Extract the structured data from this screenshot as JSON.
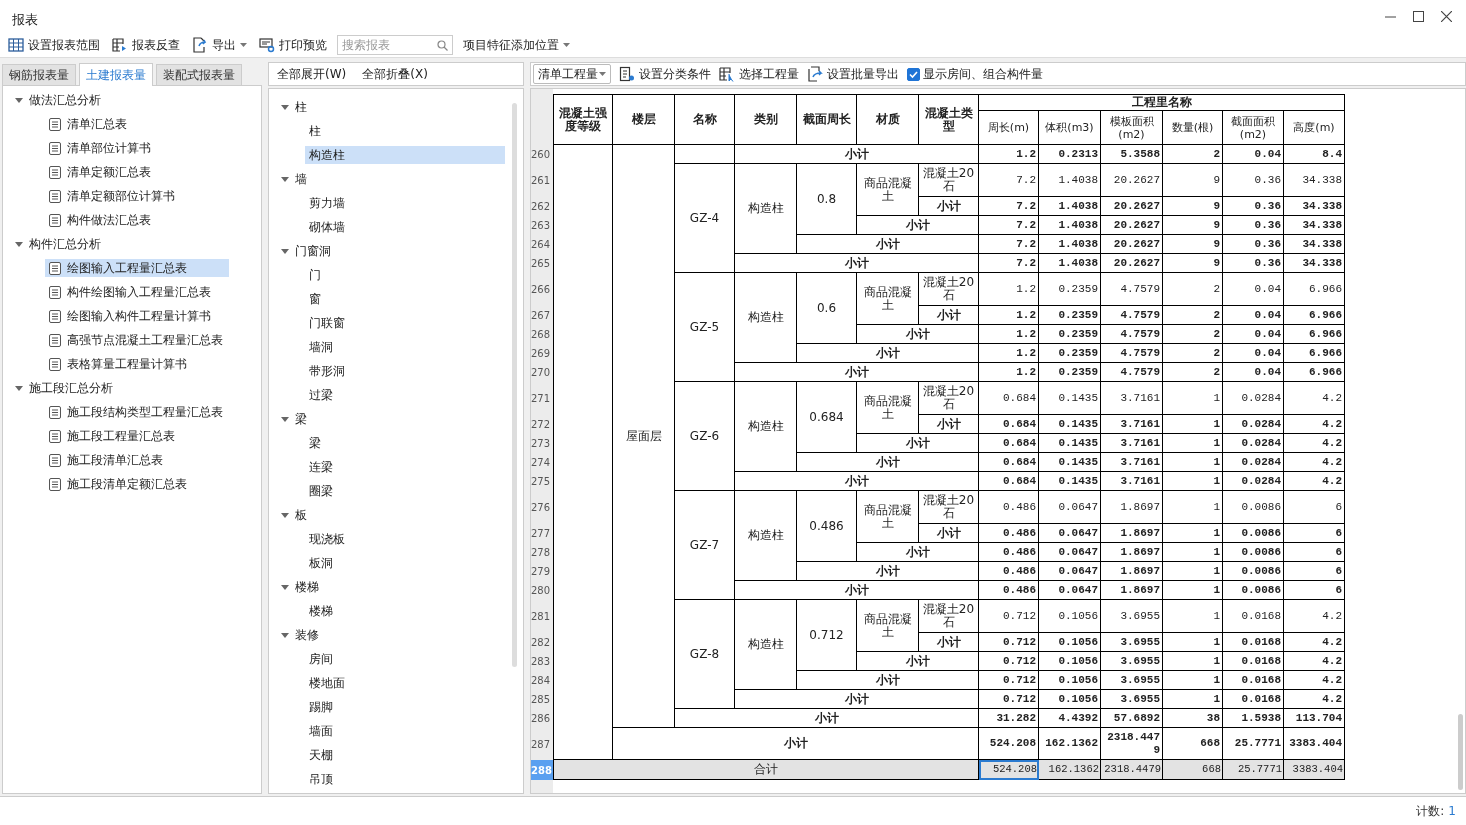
{
  "window": {
    "title": "报表"
  },
  "toolbar": {
    "buttons": [
      {
        "label": "设置报表范围",
        "dropdown": false
      },
      {
        "label": "报表反查",
        "dropdown": false
      },
      {
        "label": "导出",
        "dropdown": true
      },
      {
        "label": "打印预览",
        "dropdown": false
      }
    ],
    "search": {
      "placeholder": "搜索报表"
    },
    "position_dropdown": {
      "label": "项目特征添加位置"
    }
  },
  "tabs": [
    {
      "label": "钢筋报表量",
      "selected": false
    },
    {
      "label": "土建报表量",
      "selected": true
    },
    {
      "label": "装配式报表量",
      "selected": false
    }
  ],
  "report_tree": [
    {
      "label": "做法汇总分析",
      "expanded": true,
      "selected": false,
      "children": [
        {
          "label": "清单汇总表",
          "selected": false
        },
        {
          "label": "清单部位计算书",
          "selected": false
        },
        {
          "label": "清单定额汇总表",
          "selected": false
        },
        {
          "label": "清单定额部位计算书",
          "selected": false
        },
        {
          "label": "构件做法汇总表",
          "selected": false
        }
      ]
    },
    {
      "label": "构件汇总分析",
      "expanded": true,
      "selected": false,
      "children": [
        {
          "label": "绘图输入工程量汇总表",
          "selected": true
        },
        {
          "label": "构件绘图输入工程量汇总表",
          "selected": false
        },
        {
          "label": "绘图输入构件工程量计算书",
          "selected": false
        },
        {
          "label": "高强节点混凝土工程量汇总表",
          "selected": false
        },
        {
          "label": "表格算量工程量计算书",
          "selected": false
        }
      ]
    },
    {
      "label": "施工段汇总分析",
      "expanded": true,
      "selected": false,
      "children": [
        {
          "label": "施工段结构类型工程量汇总表",
          "selected": false
        },
        {
          "label": "施工段工程量汇总表",
          "selected": false
        },
        {
          "label": "施工段清单汇总表",
          "selected": false
        },
        {
          "label": "施工段清单定额汇总表",
          "selected": false
        }
      ]
    }
  ],
  "category_panel": {
    "buttons": [
      "全部展开(W)",
      "全部折叠(X)"
    ],
    "tree": [
      {
        "label": "柱",
        "expanded": true,
        "selected": false,
        "children": [
          {
            "label": "柱",
            "selected": false
          },
          {
            "label": "构造柱",
            "selected": true
          }
        ]
      },
      {
        "label": "墙",
        "expanded": true,
        "selected": false,
        "children": [
          {
            "label": "剪力墙",
            "selected": false
          },
          {
            "label": "砌体墙",
            "selected": false
          }
        ]
      },
      {
        "label": "门窗洞",
        "expanded": true,
        "selected": false,
        "children": [
          {
            "label": "门",
            "selected": false
          },
          {
            "label": "窗",
            "selected": false
          },
          {
            "label": "门联窗",
            "selected": false
          },
          {
            "label": "墙洞",
            "selected": false
          },
          {
            "label": "带形洞",
            "selected": false
          },
          {
            "label": "过梁",
            "selected": false
          }
        ]
      },
      {
        "label": "梁",
        "expanded": true,
        "selected": false,
        "children": [
          {
            "label": "梁",
            "selected": false
          },
          {
            "label": "连梁",
            "selected": false
          },
          {
            "label": "圈梁",
            "selected": false
          }
        ]
      },
      {
        "label": "板",
        "expanded": true,
        "selected": false,
        "children": [
          {
            "label": "现浇板",
            "selected": false
          },
          {
            "label": "板洞",
            "selected": false
          }
        ]
      },
      {
        "label": "楼梯",
        "expanded": true,
        "selected": false,
        "children": [
          {
            "label": "楼梯",
            "selected": false
          }
        ]
      },
      {
        "label": "装修",
        "expanded": true,
        "selected": false,
        "children": [
          {
            "label": "房间",
            "selected": false
          },
          {
            "label": "楼地面",
            "selected": false
          },
          {
            "label": "踢脚",
            "selected": false
          },
          {
            "label": "墙面",
            "selected": false
          },
          {
            "label": "天棚",
            "selected": false
          },
          {
            "label": "吊顶",
            "selected": false
          }
        ]
      }
    ]
  },
  "report_toolbar": {
    "quantity_type": "清单工程量",
    "buttons": [
      "设置分类条件",
      "选择工程量",
      "设置批量导出"
    ],
    "show_rooms": {
      "label": "显示房间、组合构件量",
      "checked": true
    }
  },
  "table": {
    "columns": [
      "混凝土强度等级",
      "楼层",
      "名称",
      "类别",
      "截面周长",
      "材质",
      "混凝土类型"
    ],
    "group_header": "工程里名称",
    "measures": [
      "周长(m)",
      "体积(m3)",
      "模板面积(m2)",
      "数量(根)",
      "截面面积(m2)",
      "高度(m)"
    ],
    "tree": {
      "children": [
        {
          "label": "屋面层",
          "children": [
            {
              "subtotal": {
                "number": "260",
                "label": "小计",
                "selected": false,
                "values": [
                  "1.2",
                  "0.2313",
                  "5.3588",
                  "2",
                  "0.04",
                  "8.4"
                ]
              }
            },
            {
              "label": "GZ-4",
              "children": [
                {
                  "label": "构造柱",
                  "children": [
                    {
                      "label": "0.8",
                      "children": [
                        {
                          "label": "商品混凝土",
                          "children": [
                            {
                              "number": "261",
                              "label": "混凝土20石",
                              "selected": false,
                              "values": [
                                "7.2",
                                "1.4038",
                                "20.2627",
                                "9",
                                "0.36",
                                "34.338"
                              ]
                            }
                          ],
                          "subtotal": {
                            "number": "262",
                            "label": "小计",
                            "selected": false,
                            "values": [
                              "7.2",
                              "1.4038",
                              "20.2627",
                              "9",
                              "0.36",
                              "34.338"
                            ]
                          }
                        }
                      ],
                      "subtotal": {
                        "number": "263",
                        "label": "小计",
                        "selected": false,
                        "values": [
                          "7.2",
                          "1.4038",
                          "20.2627",
                          "9",
                          "0.36",
                          "34.338"
                        ]
                      }
                    }
                  ],
                  "subtotal": {
                    "number": "264",
                    "label": "小计",
                    "selected": false,
                    "values": [
                      "7.2",
                      "1.4038",
                      "20.2627",
                      "9",
                      "0.36",
                      "34.338"
                    ]
                  }
                }
              ],
              "subtotal": {
                "number": "265",
                "label": "小计",
                "selected": false,
                "values": [
                  "7.2",
                  "1.4038",
                  "20.2627",
                  "9",
                  "0.36",
                  "34.338"
                ]
              }
            },
            {
              "label": "GZ-5",
              "children": [
                {
                  "label": "构造柱",
                  "children": [
                    {
                      "label": "0.6",
                      "children": [
                        {
                          "label": "商品混凝土",
                          "children": [
                            {
                              "number": "266",
                              "label": "混凝土20石",
                              "selected": false,
                              "values": [
                                "1.2",
                                "0.2359",
                                "4.7579",
                                "2",
                                "0.04",
                                "6.966"
                              ]
                            }
                          ],
                          "subtotal": {
                            "number": "267",
                            "label": "小计",
                            "selected": false,
                            "values": [
                              "1.2",
                              "0.2359",
                              "4.7579",
                              "2",
                              "0.04",
                              "6.966"
                            ]
                          }
                        }
                      ],
                      "subtotal": {
                        "number": "268",
                        "label": "小计",
                        "selected": false,
                        "values": [
                          "1.2",
                          "0.2359",
                          "4.7579",
                          "2",
                          "0.04",
                          "6.966"
                        ]
                      }
                    }
                  ],
                  "subtotal": {
                    "number": "269",
                    "label": "小计",
                    "selected": false,
                    "values": [
                      "1.2",
                      "0.2359",
                      "4.7579",
                      "2",
                      "0.04",
                      "6.966"
                    ]
                  }
                }
              ],
              "subtotal": {
                "number": "270",
                "label": "小计",
                "selected": false,
                "values": [
                  "1.2",
                  "0.2359",
                  "4.7579",
                  "2",
                  "0.04",
                  "6.966"
                ]
              }
            },
            {
              "label": "GZ-6",
              "children": [
                {
                  "label": "构造柱",
                  "children": [
                    {
                      "label": "0.684",
                      "children": [
                        {
                          "label": "商品混凝土",
                          "children": [
                            {
                              "number": "271",
                              "label": "混凝土20石",
                              "selected": false,
                              "values": [
                                "0.684",
                                "0.1435",
                                "3.7161",
                                "1",
                                "0.0284",
                                "4.2"
                              ]
                            }
                          ],
                          "subtotal": {
                            "number": "272",
                            "label": "小计",
                            "selected": false,
                            "values": [
                              "0.684",
                              "0.1435",
                              "3.7161",
                              "1",
                              "0.0284",
                              "4.2"
                            ]
                          }
                        }
                      ],
                      "subtotal": {
                        "number": "273",
                        "label": "小计",
                        "selected": false,
                        "values": [
                          "0.684",
                          "0.1435",
                          "3.7161",
                          "1",
                          "0.0284",
                          "4.2"
                        ]
                      }
                    }
                  ],
                  "subtotal": {
                    "number": "274",
                    "label": "小计",
                    "selected": false,
                    "values": [
                      "0.684",
                      "0.1435",
                      "3.7161",
                      "1",
                      "0.0284",
                      "4.2"
                    ]
                  }
                }
              ],
              "subtotal": {
                "number": "275",
                "label": "小计",
                "selected": false,
                "values": [
                  "0.684",
                  "0.1435",
                  "3.7161",
                  "1",
                  "0.0284",
                  "4.2"
                ]
              }
            },
            {
              "label": "GZ-7",
              "children": [
                {
                  "label": "构造柱",
                  "children": [
                    {
                      "label": "0.486",
                      "children": [
                        {
                          "label": "商品混凝土",
                          "children": [
                            {
                              "number": "276",
                              "label": "混凝土20石",
                              "selected": false,
                              "values": [
                                "0.486",
                                "0.0647",
                                "1.8697",
                                "1",
                                "0.0086",
                                "6"
                              ]
                            }
                          ],
                          "subtotal": {
                            "number": "277",
                            "label": "小计",
                            "selected": false,
                            "values": [
                              "0.486",
                              "0.0647",
                              "1.8697",
                              "1",
                              "0.0086",
                              "6"
                            ]
                          }
                        }
                      ],
                      "subtotal": {
                        "number": "278",
                        "label": "小计",
                        "selected": false,
                        "values": [
                          "0.486",
                          "0.0647",
                          "1.8697",
                          "1",
                          "0.0086",
                          "6"
                        ]
                      }
                    }
                  ],
                  "subtotal": {
                    "number": "279",
                    "label": "小计",
                    "selected": false,
                    "values": [
                      "0.486",
                      "0.0647",
                      "1.8697",
                      "1",
                      "0.0086",
                      "6"
                    ]
                  }
                }
              ],
              "subtotal": {
                "number": "280",
                "label": "小计",
                "selected": false,
                "values": [
                  "0.486",
                  "0.0647",
                  "1.8697",
                  "1",
                  "0.0086",
                  "6"
                ]
              }
            },
            {
              "label": "GZ-8",
              "children": [
                {
                  "label": "构造柱",
                  "children": [
                    {
                      "label": "0.712",
                      "children": [
                        {
                          "label": "商品混凝土",
                          "children": [
                            {
                              "number": "281",
                              "label": "混凝土20石",
                              "selected": false,
                              "values": [
                                "0.712",
                                "0.1056",
                                "3.6955",
                                "1",
                                "0.0168",
                                "4.2"
                              ]
                            }
                          ],
                          "subtotal": {
                            "number": "282",
                            "label": "小计",
                            "selected": false,
                            "values": [
                              "0.712",
                              "0.1056",
                              "3.6955",
                              "1",
                              "0.0168",
                              "4.2"
                            ]
                          }
                        }
                      ],
                      "subtotal": {
                        "number": "283",
                        "label": "小计",
                        "selected": false,
                        "values": [
                          "0.712",
                          "0.1056",
                          "3.6955",
                          "1",
                          "0.0168",
                          "4.2"
                        ]
                      }
                    }
                  ],
                  "subtotal": {
                    "number": "284",
                    "label": "小计",
                    "selected": false,
                    "values": [
                      "0.712",
                      "0.1056",
                      "3.6955",
                      "1",
                      "0.0168",
                      "4.2"
                    ]
                  }
                }
              ],
              "subtotal": {
                "number": "285",
                "label": "小计",
                "selected": false,
                "values": [
                  "0.712",
                  "0.1056",
                  "3.6955",
                  "1",
                  "0.0168",
                  "4.2"
                ]
              }
            }
          ],
          "subtotal": {
            "number": "286",
            "label": "小计",
            "selected": false,
            "values": [
              "31.282",
              "4.4392",
              "57.6892",
              "38",
              "1.5938",
              "113.704"
            ]
          }
        }
      ],
      "subtotal": {
        "number": "287",
        "label": "小计",
        "selected": false,
        "values": [
          "524.208",
          "162.1362",
          "2318.4479",
          "668",
          "25.7771",
          "3383.404"
        ]
      }
    },
    "total": {
      "number": "288",
      "label": "合计",
      "selected": true,
      "values": [
        "524.208",
        "162.1362",
        "2318.4479",
        "668",
        "25.7771",
        "3383.404"
      ]
    }
  },
  "status_bar": {
    "label": "计数:",
    "value": "1"
  }
}
